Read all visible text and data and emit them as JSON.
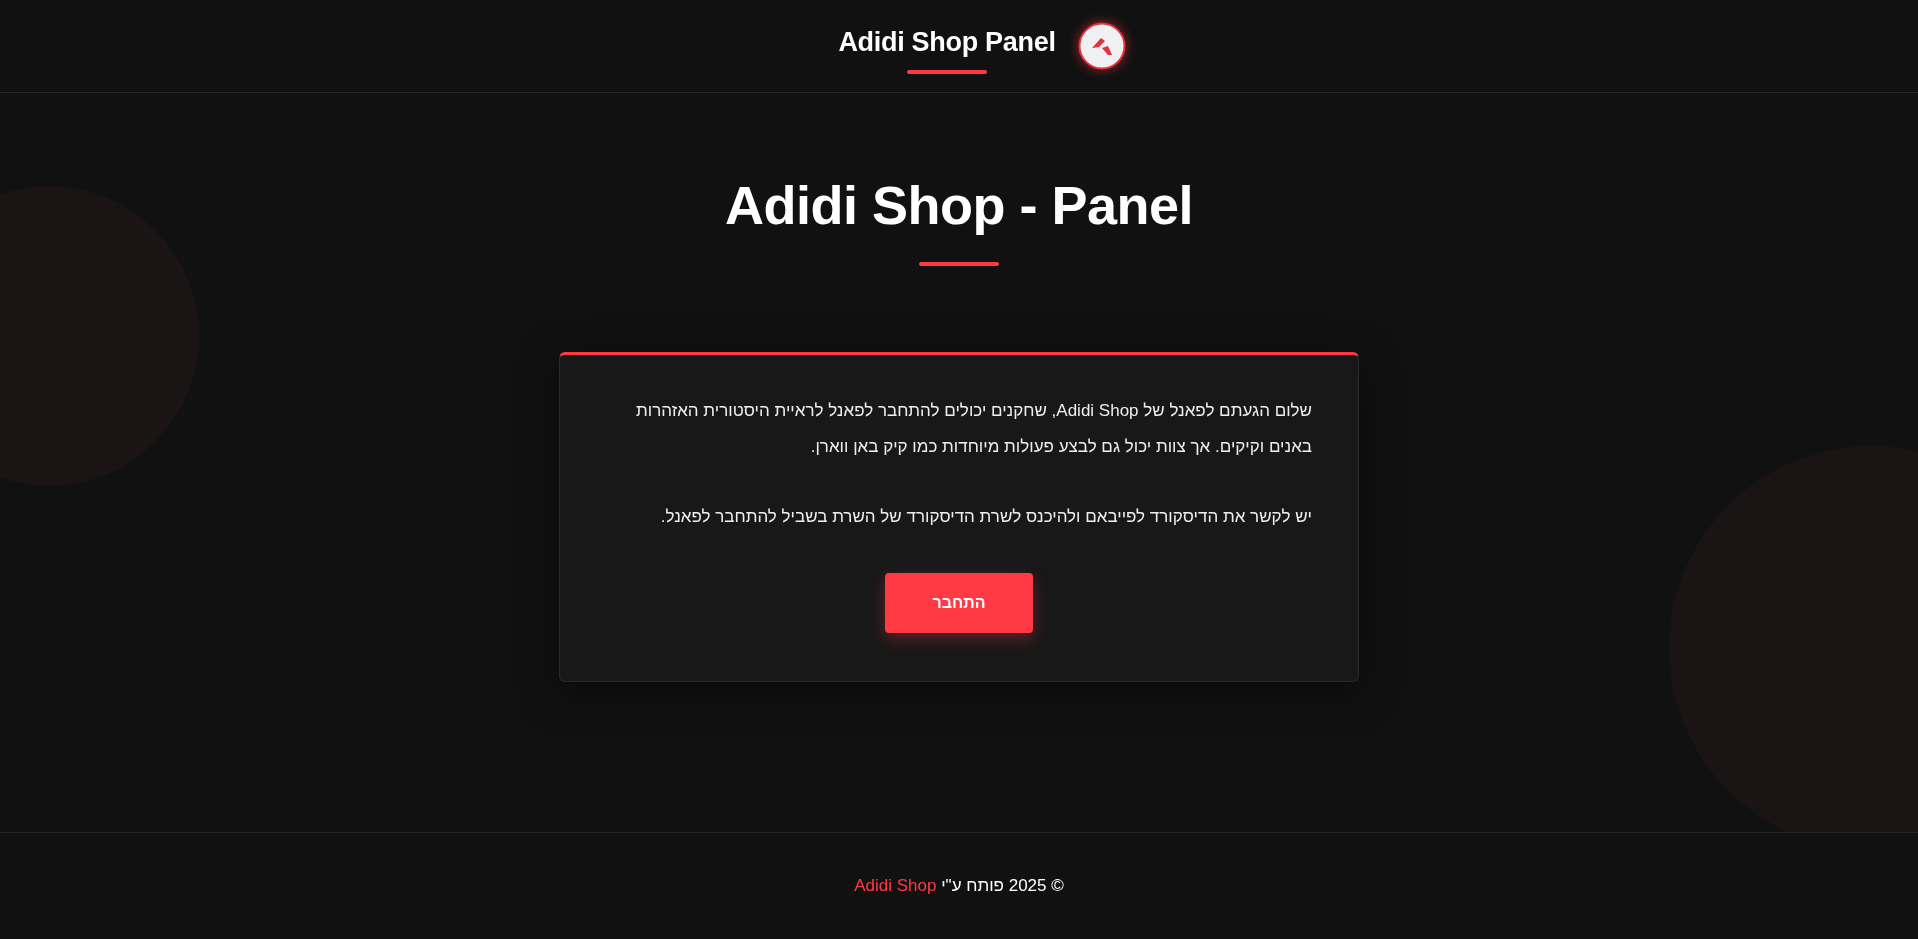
{
  "header": {
    "title": "Adidi Shop Panel"
  },
  "page_title": "Adidi Shop - Panel",
  "card": {
    "paragraphs": [
      "שלום הגעתם לפאנל של Adidi Shop, שחקנים יכולים להתחבר לפאנל לראיית היסטורית האזהרות באנים וקיקים. אך צוות יכול גם לבצע פעולות מיוחדות כמו קיק באן ווארן.",
      "יש לקשר את הדיסקורד לפייבאם ולהיכנס לשרת הדיסקורד של השרת בשביל להתחבר לפאנל."
    ],
    "button": "התחבר"
  },
  "footer": {
    "text": "© 2025 פותח ע\"י",
    "link": "Adidi Shop"
  }
}
